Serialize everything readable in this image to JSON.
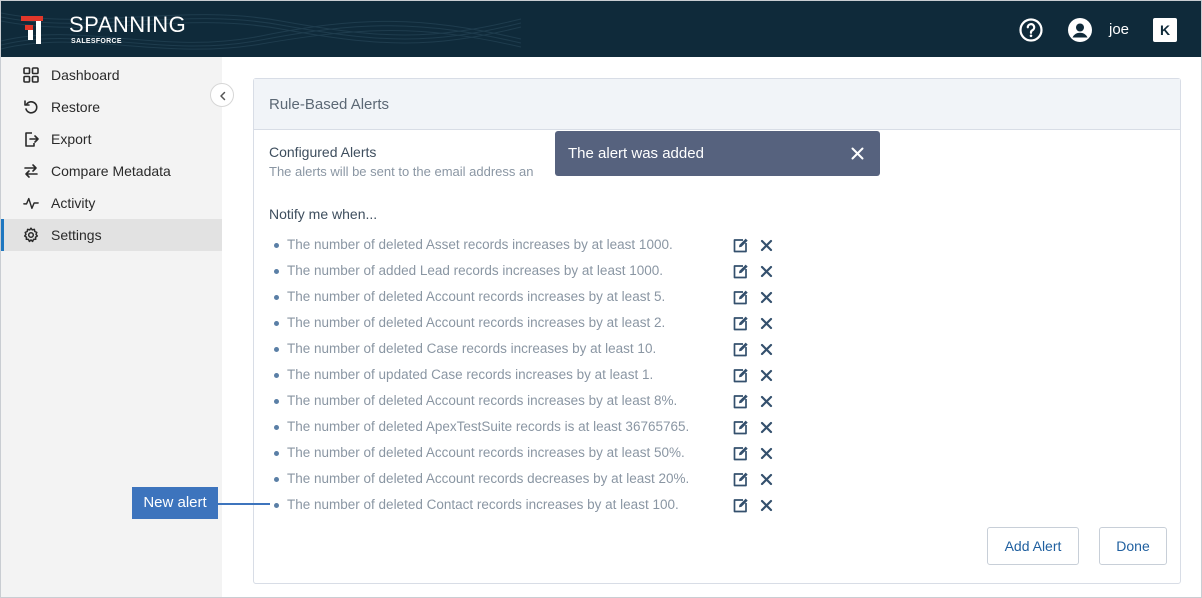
{
  "header": {
    "logo_title": "SPANNING",
    "logo_subtitle": "SALESFORCE",
    "username": "joe",
    "icons": [
      "help-icon",
      "user-icon",
      "brand-icon"
    ],
    "brand_glyph": "K"
  },
  "sidebar": {
    "items": [
      {
        "label": "Dashboard",
        "icon": "dashboard-icon"
      },
      {
        "label": "Restore",
        "icon": "restore-icon"
      },
      {
        "label": "Export",
        "icon": "export-icon"
      },
      {
        "label": "Compare Metadata",
        "icon": "compare-icon"
      },
      {
        "label": "Activity",
        "icon": "activity-icon"
      },
      {
        "label": "Settings",
        "icon": "gear-icon",
        "active": true
      }
    ]
  },
  "card": {
    "title": "Rule-Based Alerts",
    "configured_title": "Configured Alerts",
    "configured_desc": "The alerts will be sent to the email address an",
    "notify_label": "Notify me when...",
    "alerts": [
      "The number of deleted Asset records increases by at least 1000.",
      "The number of added Lead records increases by at least 1000.",
      "The number of deleted Account records increases by at least 5.",
      "The number of deleted Account records increases by at least 2.",
      "The number of deleted Case records increases by at least 10.",
      "The number of updated Case records increases by at least 1.",
      "The number of deleted Account records increases by at least 8%.",
      "The number of deleted ApexTestSuite records is at least 36765765.",
      "The number of deleted Account records increases by at least 50%.",
      "The number of deleted Account records decreases by at least 20%.",
      "The number of deleted Contact records increases by at least 100."
    ],
    "add_button": "Add Alert",
    "done_button": "Done"
  },
  "toast": {
    "message": "The alert was added"
  },
  "callout": {
    "label": "New alert"
  },
  "colors": {
    "topbar": "#0f2a3a",
    "accent": "#1f77c0",
    "toast": "#56627e",
    "callout": "#3d74bd"
  }
}
